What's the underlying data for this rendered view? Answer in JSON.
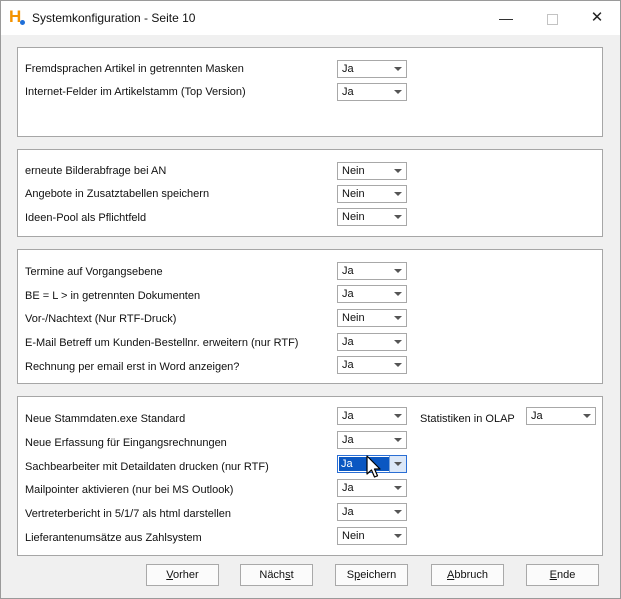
{
  "window": {
    "title": "Systemkonfiguration - Seite 10",
    "minimize_glyph": "—",
    "close_glyph": "✕"
  },
  "groups": [
    {
      "rows": [
        {
          "label": "Fremdsprachen Artikel in getrennten Masken",
          "value": "Ja"
        },
        {
          "label": "Internet-Felder im Artikelstamm (Top Version)",
          "value": "Ja"
        }
      ]
    },
    {
      "rows": [
        {
          "label": "erneute Bilderabfrage bei AN",
          "value": "Nein"
        },
        {
          "label": "Angebote in Zusatztabellen speichern",
          "value": "Nein"
        },
        {
          "label": "Ideen-Pool als Pflichtfeld",
          "value": "Nein"
        }
      ]
    },
    {
      "rows": [
        {
          "label": "Termine auf Vorgangsebene",
          "value": "Ja"
        },
        {
          "label": "BE = L > in getrennten Dokumenten",
          "value": "Ja"
        },
        {
          "label": "Vor-/Nachtext (Nur RTF-Druck)",
          "value": "Nein"
        },
        {
          "label": "E-Mail Betreff um Kunden-Bestellnr. erweitern (nur RTF)",
          "value": "Ja"
        },
        {
          "label": "Rechnung per email erst in Word anzeigen?",
          "value": "Ja"
        }
      ]
    },
    {
      "rows": [
        {
          "label": "Neue Stammdaten.exe Standard",
          "value": "Ja"
        },
        {
          "label": "Neue Erfassung für Eingangsrechnungen",
          "value": "Ja"
        },
        {
          "label": "Sachbearbeiter mit Detaildaten drucken (nur RTF)",
          "value": "Ja"
        },
        {
          "label": "Mailpointer aktivieren (nur bei MS Outlook)",
          "value": "Ja"
        },
        {
          "label": "Vertreterbericht in 5/1/7 als html darstellen",
          "value": "Ja"
        },
        {
          "label": "Lieferantenumsätze aus Zahlsystem",
          "value": "Nein"
        }
      ],
      "extra": {
        "label": "Statistiken in OLAP",
        "value": "Ja"
      }
    }
  ],
  "buttons": {
    "prev": {
      "mnemonic": "V",
      "rest": "orher"
    },
    "next": {
      "pre": "Näch",
      "mnemonic": "s",
      "rest": "t"
    },
    "save": {
      "pre": "S",
      "mnemonic": "p",
      "rest": "eichern"
    },
    "cancel": {
      "mnemonic": "A",
      "rest": "bbruch"
    },
    "end": {
      "mnemonic": "E",
      "rest": "nde"
    }
  }
}
